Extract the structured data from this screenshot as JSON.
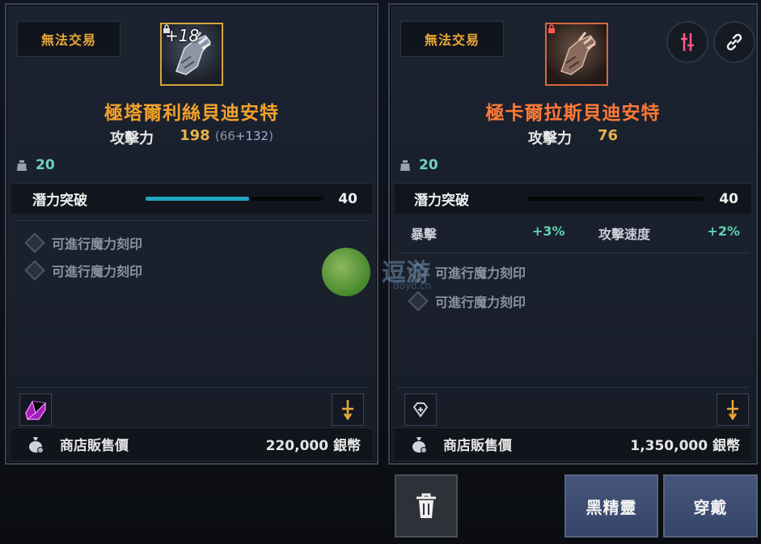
{
  "left_item": {
    "trade_tag": "無法交易",
    "enhance_level": "+18",
    "name": "極塔爾利絲貝迪安特",
    "attack_label": "攻擊力",
    "attack_value": "198",
    "attack_base": "66",
    "attack_bonus": "+132",
    "tier": "20",
    "potential_label": "潛力突破",
    "potential_value": "40",
    "potential_fill_fraction": 0.58,
    "engrave_1": "可進行魔力刻印",
    "engrave_2": "可進行魔力刻印",
    "sell_label": "商店販售價",
    "sell_price": "220,000 銀幣"
  },
  "right_item": {
    "trade_tag": "無法交易",
    "name": "極卡爾拉斯貝迪安特",
    "attack_label": "攻擊力",
    "attack_value": "76",
    "tier": "20",
    "potential_label": "潛力突破",
    "potential_value": "40",
    "potential_fill_fraction": 0.0,
    "stat_1_name": "暴擊",
    "stat_1_value": "+3%",
    "stat_2_name": "攻擊速度",
    "stat_2_value": "+2%",
    "engrave_1": "可進行魔力刻印",
    "engrave_2": "可進行魔力刻印",
    "sell_label": "商店販售價",
    "sell_price": "1,350,000 銀幣"
  },
  "actions": {
    "dark_elf_label": "黑精靈",
    "equip_label": "穿戴"
  },
  "watermark": {
    "text": "逗游",
    "sub": "doyo.cn"
  },
  "colors": {
    "legendary_name": "#f2a22c",
    "mythic_name": "#ff7a36",
    "attack_value": "#e7b34b",
    "tier_teal": "#6ed3c6",
    "potential_bar": "#1fa6c1",
    "stat_positive": "#5fd1b0",
    "untradable_tag": "#e8a838"
  },
  "icons": [
    "weight-icon",
    "lock-icon",
    "crystal-gem-icon",
    "sword-upgrade-icon",
    "empty-gem-slot-icon",
    "coin-bag-icon",
    "double-sword-icon",
    "link-icon",
    "trash-icon",
    "diamond-slot-icon"
  ]
}
